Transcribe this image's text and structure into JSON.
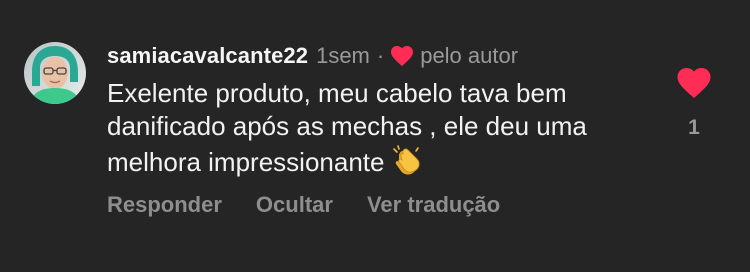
{
  "comment": {
    "username": "samiacavalcante22",
    "time": "1sem",
    "separator": "·",
    "author_like_label": "pelo autor",
    "text": "Exelente produto, meu cabelo tava bem danificado após as mechas , ele deu uma melhora impressionante",
    "emoji_icon": "clapping-hands-icon",
    "like_count": "1",
    "actions": {
      "reply": "Responder",
      "hide": "Ocultar",
      "translate": "Ver tradução"
    }
  },
  "colors": {
    "background": "#252525",
    "heart": "#ff2d55",
    "muted_text": "#9a9a9a"
  }
}
